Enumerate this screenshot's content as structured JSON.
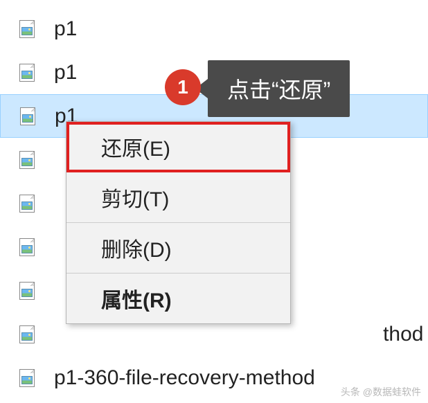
{
  "files": [
    {
      "name": "p1",
      "selected": false
    },
    {
      "name": "p1",
      "selected": false
    },
    {
      "name": "p1",
      "selected": true
    },
    {
      "name": "",
      "selected": false
    },
    {
      "name": "",
      "selected": false
    },
    {
      "name": "",
      "selected": false
    },
    {
      "name": "",
      "selected": false
    },
    {
      "name": "                                                         thod",
      "selected": false
    },
    {
      "name": "p1-360-file-recovery-method",
      "selected": false
    }
  ],
  "menu": {
    "restore": "还原(E)",
    "cut": "剪切(T)",
    "delete": "删除(D)",
    "properties": "属性(R)"
  },
  "callout": {
    "number": "1",
    "text": "点击“还原”"
  },
  "watermark": "头条 @数据蛙软件"
}
